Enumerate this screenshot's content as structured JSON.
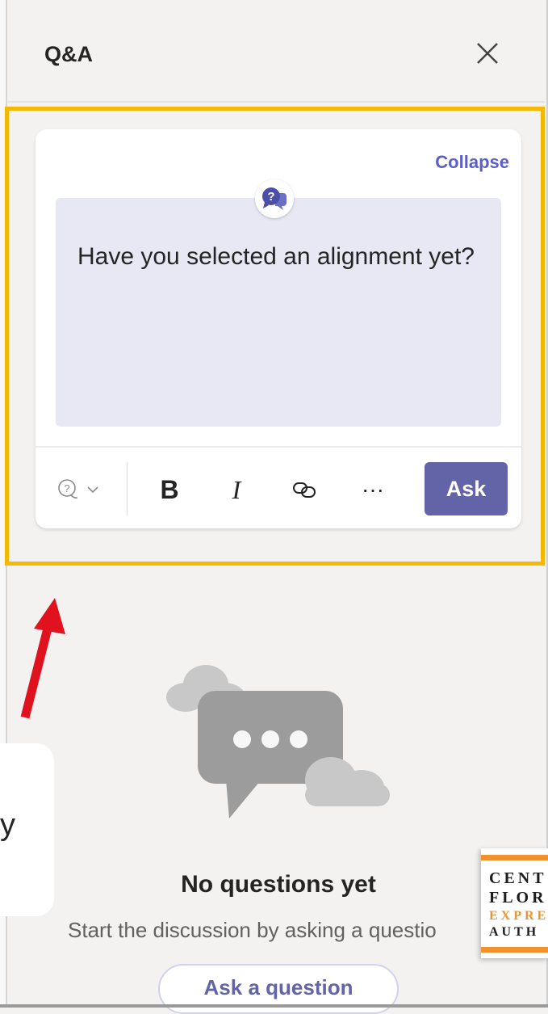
{
  "panel": {
    "title": "Q&A",
    "close_icon": "close-icon"
  },
  "composer": {
    "collapse_label": "Collapse",
    "question_text": "Have you selected an alignment yet?",
    "badge_icon": "question-chat-icon",
    "toolbar": {
      "type_icon": "question-type-icon",
      "bold_label": "B",
      "italic_label": "I",
      "link_icon": "link-icon",
      "more_label": "···",
      "ask_label": "Ask"
    }
  },
  "tooltip": {
    "visible_fragment": "y"
  },
  "empty_state": {
    "illustration_icon": "chat-bubble-clouds-illustration",
    "title": "No questions yet",
    "subtitle": "Start the discussion by asking a questio",
    "button_label": "Ask a question"
  },
  "logo": {
    "line1": "CENT",
    "line2": "FLOR",
    "line3": "EXPRE",
    "line4": "AUTH"
  },
  "colors": {
    "accent": "#6264a7",
    "highlight": "#f5b800",
    "arrow": "#e0121e",
    "logo_orange": "#f0922b"
  }
}
